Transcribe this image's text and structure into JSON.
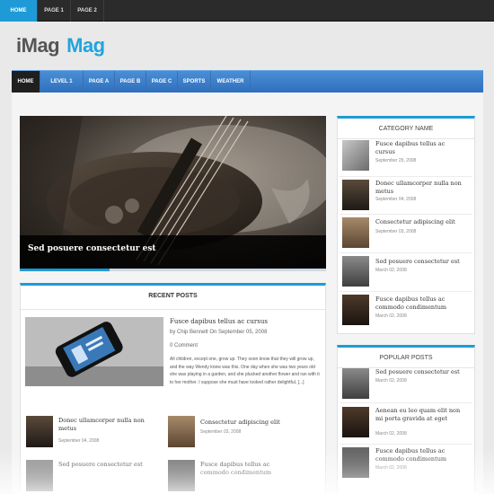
{
  "topnav": {
    "items": [
      {
        "label": "HOME"
      },
      {
        "label": "PAGE 1"
      },
      {
        "label": "PAGE 2"
      }
    ]
  },
  "logo": {
    "part1": "iMag",
    "part2": "Mag"
  },
  "mainnav": {
    "items": [
      {
        "label": "HOME"
      },
      {
        "label": "LEVEL 1"
      },
      {
        "label": "PAGE A"
      },
      {
        "label": "PAGE B"
      },
      {
        "label": "PAGE C"
      },
      {
        "label": "SPORTS"
      },
      {
        "label": "WEATHER"
      }
    ]
  },
  "slider": {
    "caption": "Sed posuere consectetur est"
  },
  "recent": {
    "title": "RECENT POSTS",
    "featured": {
      "title": "Fusce dapibus tellus ac cursus",
      "meta": "by Chip Bennett  On September 05, 2008",
      "comments": "0 Comment",
      "excerpt": "All children, except one, grow up. They soon know that they will grow up, and the way Wendy knew was this. One day when she was two years old she was playing in a garden, and she plucked another flower and ran with it to her mother. I suppose she must have looked rather delightful, [...]"
    },
    "posts": [
      {
        "title": "Donec ullamcorper nulla non metus",
        "date": "September 04, 2008"
      },
      {
        "title": "Consectetur adipiscing elit",
        "date": "September 03, 2008"
      },
      {
        "title": "Sed posuere consectetur est",
        "date": ""
      },
      {
        "title": "Fusce dapibus tellus ac commodo condimentum",
        "date": ""
      }
    ]
  },
  "category": {
    "title": "CATEGORY NAME",
    "items": [
      {
        "title": "Fusce dapibus tellus ac cursus",
        "date": "September 25, 2008"
      },
      {
        "title": "Donec ullamcorper nulla non metus",
        "date": "September 04, 2008"
      },
      {
        "title": "Consectetur adipiscing elit",
        "date": "September 03, 2008"
      },
      {
        "title": "Sed posuere consectetur est",
        "date": "March 02, 2008"
      },
      {
        "title": "Fusce dapibus tellus ac commodo condimentum",
        "date": "March 02, 2008"
      }
    ]
  },
  "popular": {
    "title": "POPULAR POSTS",
    "items": [
      {
        "title": "Sed posuere consectetur est",
        "date": "March 02, 2008"
      },
      {
        "title": "Aenean eu leo quam elit non mi porta gravida at eget",
        "date": "March 02, 2008"
      },
      {
        "title": "Fusce dapibus tellus ac commodo condimentum",
        "date": "March 02, 2008"
      }
    ]
  },
  "colors": {
    "accent": "#1e9bd6",
    "nav": "#3a7fcc",
    "topbar": "#2b2b2b"
  }
}
